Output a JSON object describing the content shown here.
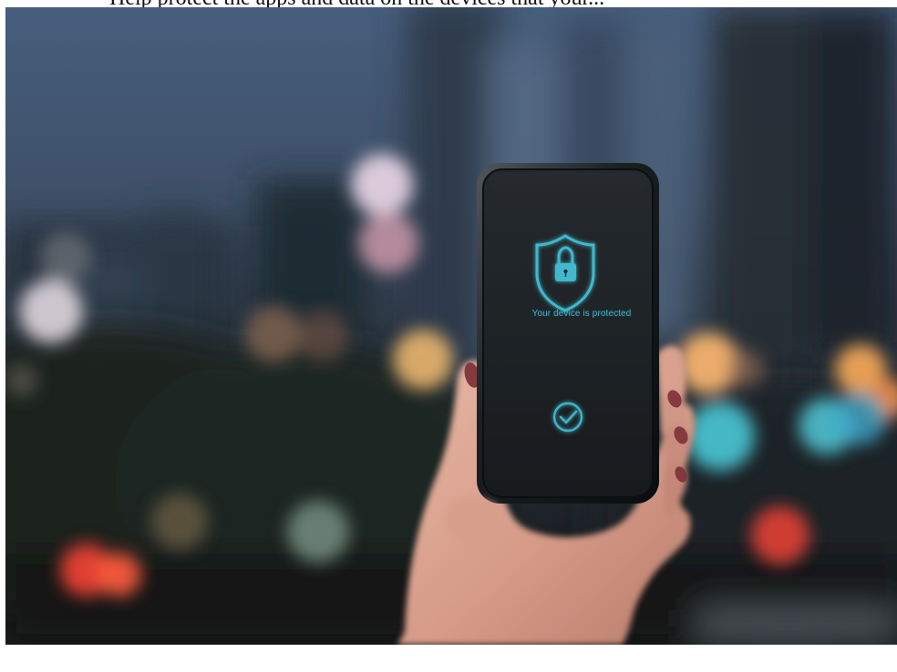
{
  "page": {
    "top_cropped_text": "Help protect the apps and data on the devices that your..."
  },
  "phone": {
    "status_message": "Your device is protected"
  },
  "icons": {
    "shield": "shield-lock-icon",
    "check": "check-circle-icon"
  },
  "colors": {
    "screen_accent": "#3fb3c8",
    "bokeh_warm": "#f1b470",
    "bokeh_red": "#f04a35",
    "bokeh_teal": "#4cc8d7",
    "sky": "#435a76"
  }
}
